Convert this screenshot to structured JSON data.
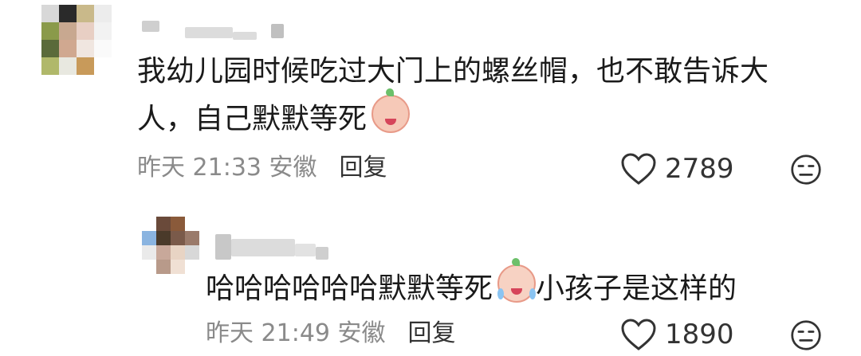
{
  "comments": [
    {
      "text_line1": "我幼儿园时候吃过大门上的螺丝帽，也不敢告诉大",
      "text_line2": "人，自己默默等死",
      "emoji": "blushing-peach-face-icon",
      "meta_time": "昨天 21:33 安徽",
      "reply_label": "回复",
      "likes": "2789"
    },
    {
      "text": "哈哈哈哈哈哈默默等死",
      "emoji": "crying-laughing-peach-face-icon",
      "text_after": "小孩子是这样的",
      "meta_time": "昨天 21:49 安徽",
      "reply_label": "回复",
      "likes": "1890"
    }
  ],
  "colors": {
    "meta": "#8a8a8a",
    "text": "#1a1a1a"
  }
}
